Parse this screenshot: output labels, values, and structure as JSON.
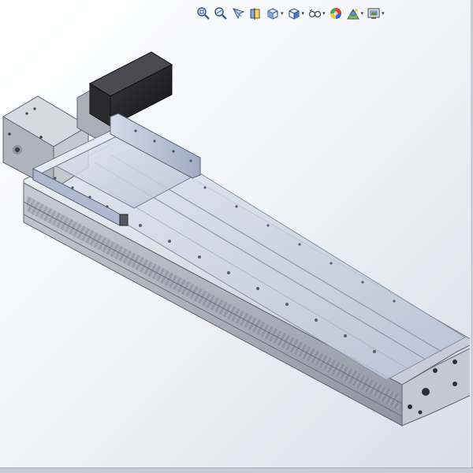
{
  "window": {
    "title": ""
  },
  "heads_up_toolbar": {
    "items": [
      {
        "icon": "zoom-to-fit-icon",
        "has_dropdown": false
      },
      {
        "icon": "zoom-to-area-icon",
        "has_dropdown": false
      },
      {
        "icon": "previous-view-icon",
        "has_dropdown": false
      },
      {
        "icon": "section-view-icon",
        "has_dropdown": false
      },
      {
        "icon": "view-orientation-icon",
        "has_dropdown": true
      },
      {
        "icon": "display-style-icon",
        "has_dropdown": true
      },
      {
        "icon": "hide-show-items-icon",
        "has_dropdown": true
      },
      {
        "icon": "edit-appearance-icon",
        "has_dropdown": false
      },
      {
        "icon": "apply-scene-icon",
        "has_dropdown": true
      },
      {
        "icon": "view-settings-icon",
        "has_dropdown": true
      }
    ]
  },
  "model": {
    "description_visible": false,
    "colors": {
      "aluminum_light": "#e4e7ee",
      "aluminum_mid": "#b9bec8",
      "aluminum_dark": "#7d838e",
      "motor_black": "#1f1f22",
      "glass_tint": "#c9d3e3",
      "carriage_blue_gray": "#b8c3d6"
    }
  },
  "viewport": {
    "background_top": "#ffffff",
    "background_bottom": "#d9dde6"
  }
}
